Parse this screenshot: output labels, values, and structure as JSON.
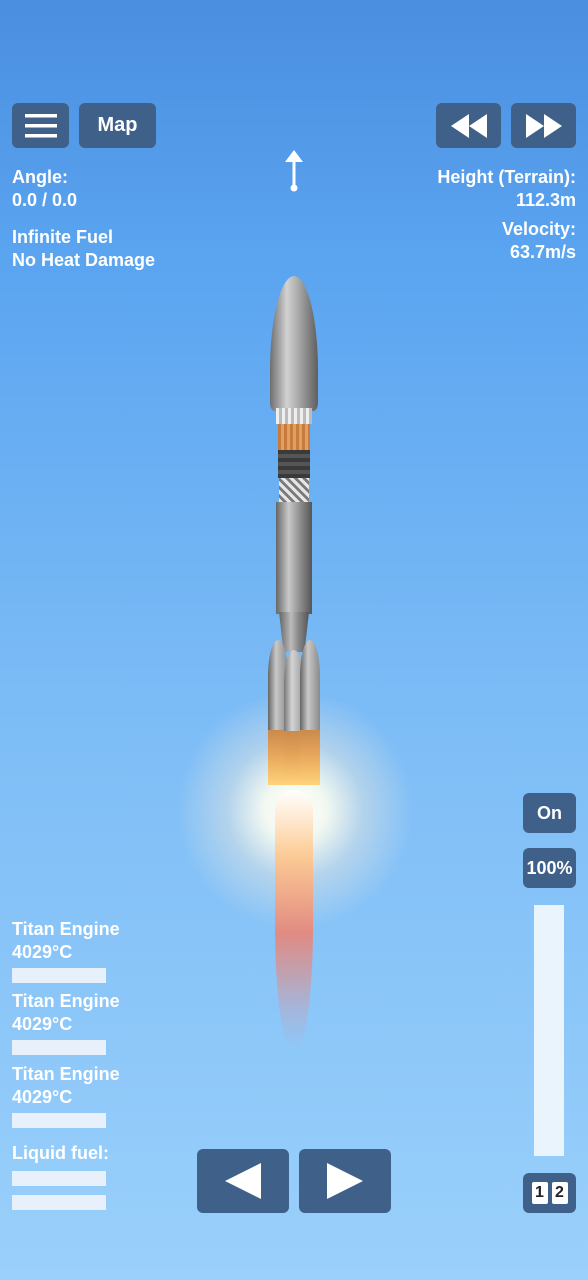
{
  "top_bar": {
    "menu_icon": "hamburger-icon",
    "map_label": "Map",
    "rewind_icon": "rewind-icon",
    "fast_forward_icon": "fast-forward-icon"
  },
  "left_info": {
    "angle_label": "Angle:",
    "angle_value": "0.0 / 0.0",
    "cheat_1": "Infinite Fuel",
    "cheat_2": "No Heat Damage"
  },
  "right_info": {
    "height_label": "Height (Terrain):",
    "height_value": "112.3m",
    "velocity_label": "Velocity:",
    "velocity_value": "63.7m/s"
  },
  "direction_indicator": "up-arrow-icon",
  "engines": [
    {
      "name": "Titan Engine",
      "temp": "4029°C"
    },
    {
      "name": "Titan Engine",
      "temp": "4029°C"
    },
    {
      "name": "Titan Engine",
      "temp": "4029°C"
    }
  ],
  "fuel": {
    "label": "Liquid fuel:"
  },
  "controls": {
    "on_label": "On",
    "throttle_label": "100%",
    "throttle_level": 1.0,
    "stage_1": "1",
    "stage_2": "2",
    "left_icon": "left-arrow-icon",
    "right_icon": "right-arrow-icon"
  },
  "colors": {
    "button": "#3f6088",
    "sky_top": "#4a8ee0",
    "sky_bottom": "#9ad0fb"
  }
}
